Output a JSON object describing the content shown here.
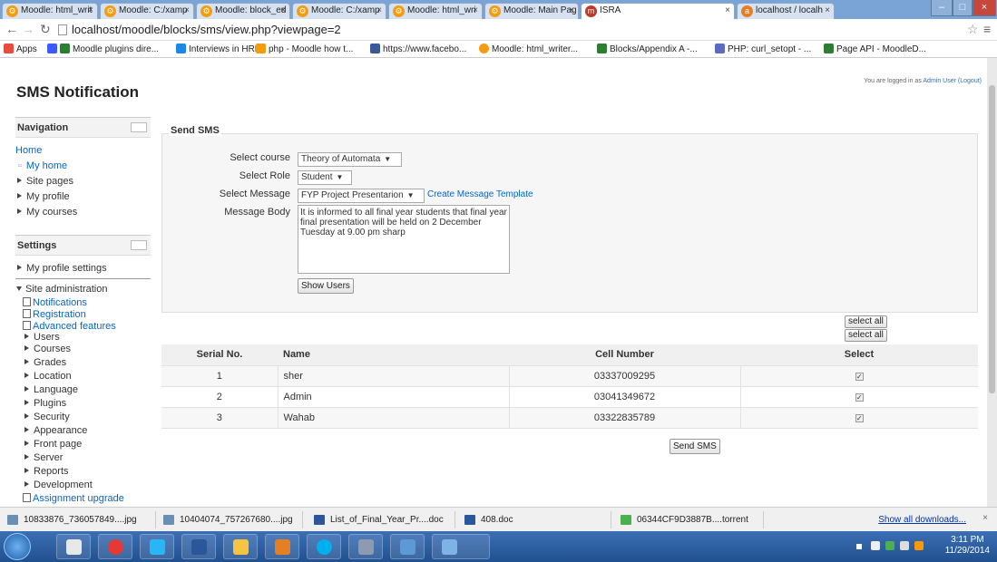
{
  "browser": {
    "tabs": [
      {
        "label": "Moodle: html_writ"
      },
      {
        "label": "Moodle: C:/xamp"
      },
      {
        "label": "Moodle: block_ed"
      },
      {
        "label": "Moodle: C:/xamp"
      },
      {
        "label": "Moodle: html_wri"
      },
      {
        "label": "Moodle: Main Pag"
      },
      {
        "label": "ISRA"
      },
      {
        "label": "localhost / localh"
      }
    ],
    "url": "localhost/moodle/blocks/sms/view.php?viewpage=2",
    "bookmarks": [
      {
        "label": "Apps"
      },
      {
        "label": "Moodle plugins dire..."
      },
      {
        "label": "Interviews in HRM"
      },
      {
        "label": "php - Moodle how t..."
      },
      {
        "label": "https://www.facebo..."
      },
      {
        "label": "Moodle: html_writer..."
      },
      {
        "label": "Blocks/Appendix A -..."
      },
      {
        "label": "PHP: curl_setopt - ..."
      },
      {
        "label": "Page API - MoodleD..."
      }
    ]
  },
  "page": {
    "title": "SMS Notification",
    "login_text": "You are logged in as",
    "login_user": "Admin User",
    "logout": "(Logout)"
  },
  "navigation": {
    "title": "Navigation",
    "home": "Home",
    "items": [
      "My home",
      "Site pages",
      "My profile",
      "My courses"
    ]
  },
  "settings": {
    "title": "Settings",
    "profile": "My profile settings",
    "site_admin": "Site administration",
    "admin_links": [
      "Notifications",
      "Registration",
      "Advanced features"
    ],
    "admin_items": [
      "Users",
      "Courses",
      "Grades",
      "Location",
      "Language",
      "Plugins",
      "Security",
      "Appearance",
      "Front page",
      "Server",
      "Reports",
      "Development",
      "Assignment upgrade"
    ]
  },
  "form": {
    "legend": "Send SMS",
    "course_label": "Select course",
    "course_value": "Theory of Automata",
    "role_label": "Select Role",
    "role_value": "Student",
    "message_label": "Select Message",
    "message_value": "FYP Project Presentarion",
    "template_link": "Create Message Template",
    "body_label": "Message Body",
    "body_value": "It is informed to all final year students that final year final presentation will be held on 2 December Tuesday at 9.00 pm sharp",
    "show_users": "Show Users"
  },
  "table": {
    "select_all": "select all",
    "headers": [
      "Serial No.",
      "Name",
      "Cell Number",
      "Select"
    ],
    "rows": [
      {
        "serial": "1",
        "name": "sher",
        "cell": "03337009295"
      },
      {
        "serial": "2",
        "name": "Admin",
        "cell": "03041349672"
      },
      {
        "serial": "3",
        "name": "Wahab",
        "cell": "03322835789"
      }
    ],
    "send_button": "Send SMS"
  },
  "downloads": {
    "items": [
      "10833876_736057849....jpg",
      "10404074_757267680....jpg",
      "List_of_Final_Year_Pr....doc",
      "408.doc",
      "06344CF9D3887B....torrent"
    ],
    "show_all": "Show all downloads...",
    "close": "×"
  },
  "taskbar": {
    "time": "3:11 PM",
    "date": "11/29/2014"
  },
  "colors": {
    "link": "#0066cc",
    "tab_strip": "#7aa4d6",
    "taskbar": "#2b5ea0"
  }
}
